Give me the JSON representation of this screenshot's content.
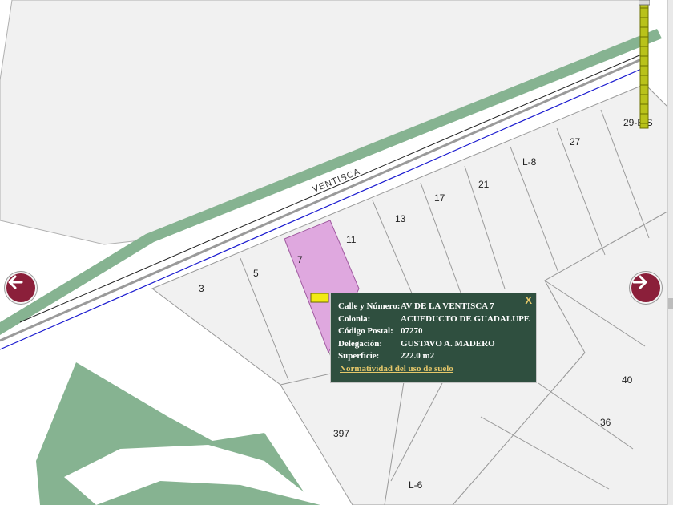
{
  "map": {
    "street_name": "VENTISCA",
    "lot_labels": {
      "lot_3": "3",
      "lot_5": "5",
      "lot_7": "7",
      "lot_11": "11",
      "lot_13": "13",
      "lot_17": "17",
      "lot_21": "21",
      "lot_l8": "L-8",
      "lot_27": "27",
      "lot_29bis": "29-BIS",
      "lot_40": "40",
      "lot_36": "36",
      "lot_397": "397",
      "lot_l6": "L-6"
    },
    "colors": {
      "background": "#ffffff",
      "block_fill": "#f1f1f1",
      "block_stroke": "#9a9a9a",
      "green_area": "#86b391",
      "selected_lot": "#dfa8df",
      "selected_lot_stroke": "#a05aa0",
      "blue_line": "#1b1bd0",
      "marker": "#f2ea13"
    }
  },
  "nav": {
    "left_icon": "arrow-left-icon",
    "right_icon": "arrow-right-icon",
    "button_color": "#8b1f3a"
  },
  "zoom": {
    "icon": "zoom-slider",
    "color": "#b9c21a"
  },
  "popup": {
    "close_label": "X",
    "rows": [
      {
        "label": "Calle y Número:",
        "value": "AV DE LA VENTISCA 7"
      },
      {
        "label": "Colonia:",
        "value": "ACUEDUCTO DE GUADALUPE"
      },
      {
        "label": "Código Postal:",
        "value": "07270"
      },
      {
        "label": "Delegación:",
        "value": "GUSTAVO A. MADERO"
      },
      {
        "label": "Superficie:",
        "value": "222.0 m2"
      }
    ],
    "link_label": "Normatividad del uso de suelo",
    "background_color": "#2f4f3f",
    "link_color": "#e6c86a"
  }
}
